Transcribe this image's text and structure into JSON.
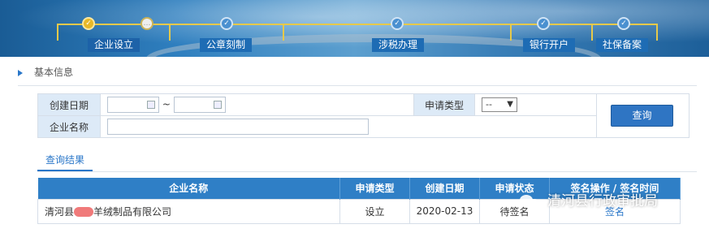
{
  "steps": [
    "企业设立",
    "公章刻制",
    "涉税办理",
    "银行开户",
    "社保备案"
  ],
  "section_title": "基本信息",
  "form": {
    "create_date_label": "创建日期",
    "date_sep": "~",
    "apply_type_label": "申请类型",
    "apply_type_value": "--",
    "company_name_label": "企业名称",
    "query_button": "查询"
  },
  "result_tab": "查询结果",
  "table": {
    "headers": [
      "企业名称",
      "申请类型",
      "创建日期",
      "申请状态",
      "签名操作 / 签名时间"
    ],
    "rows": [
      {
        "name_prefix": "清河县",
        "name_suffix": "羊绒制品有限公司",
        "type": "设立",
        "date": "2020-02-13",
        "status": "待签名",
        "action": "签名"
      }
    ]
  },
  "watermark": "清河县行政审批局",
  "icons": {
    "calendar": "calendar-icon",
    "dropdown": "dropdown-arrow-icon",
    "section": "triangle-bullet-icon",
    "wechat": "wechat-icon"
  }
}
